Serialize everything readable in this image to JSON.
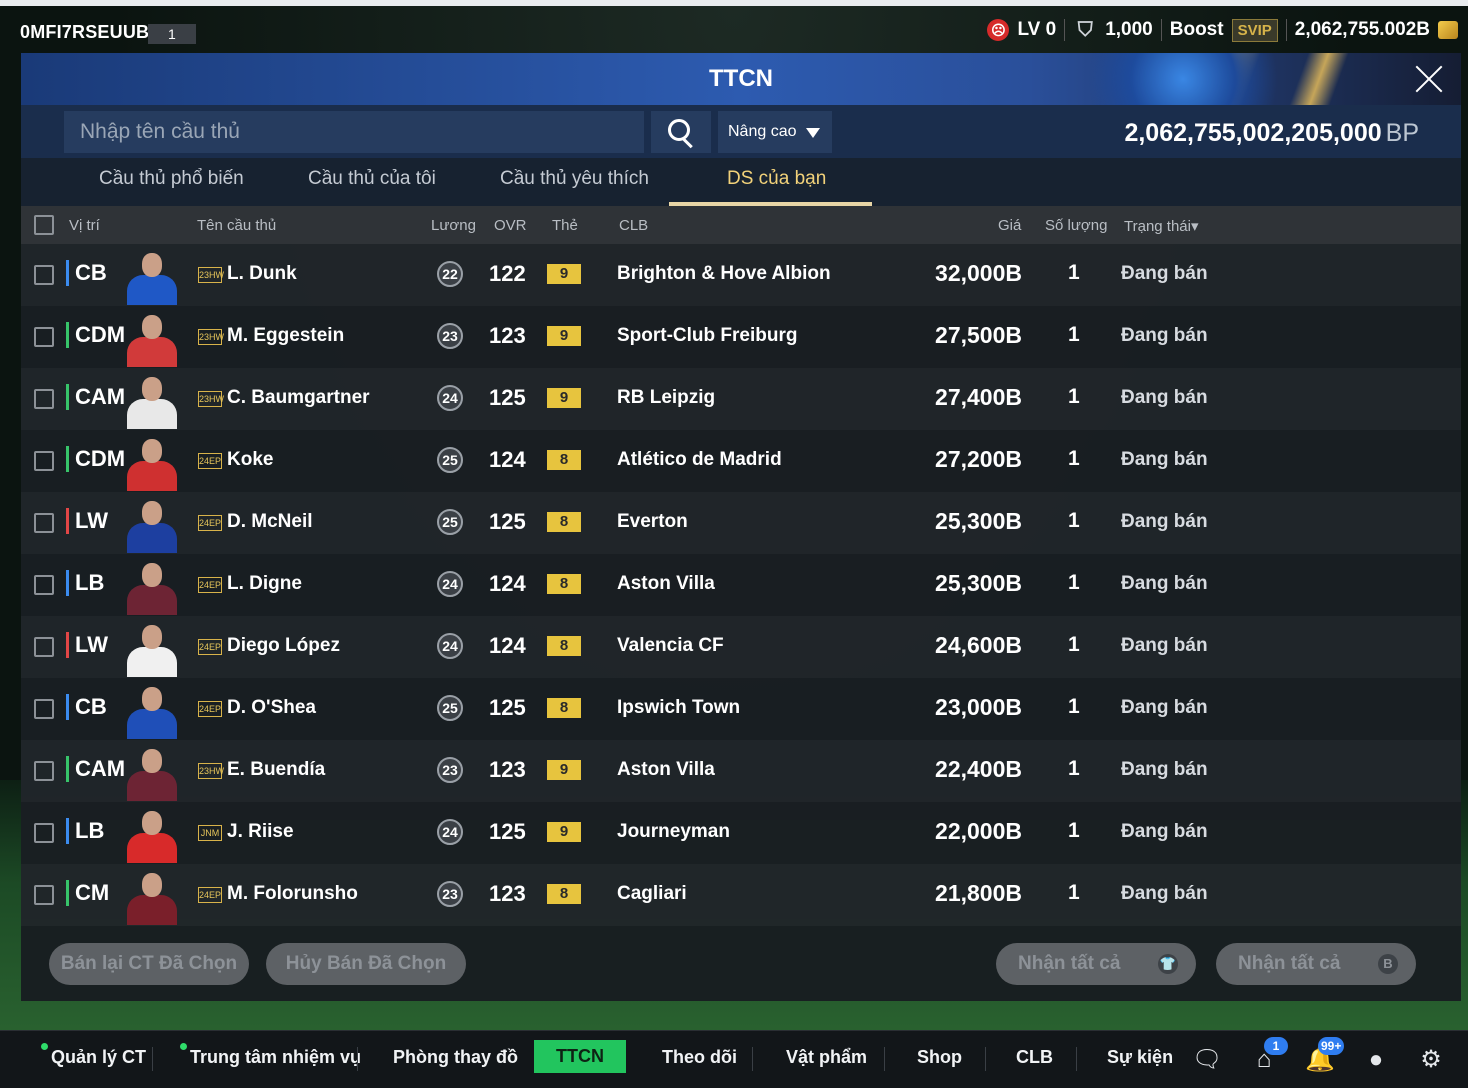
{
  "topbar": {
    "user_id": "0MFI7RSEUUB1",
    "user_level": "1",
    "lv_label": "LV 0",
    "shield_value": "1,000",
    "boost_label": "Boost",
    "svip_label": "SVIP",
    "currency_value": "2,062,755.002B"
  },
  "panel": {
    "title": "TTCN",
    "search_placeholder": "Nhập tên cầu thủ",
    "advanced_label": "Nâng cao",
    "bp_amount": "2,062,755,002,205,000",
    "bp_unit": "BP"
  },
  "tabs": [
    {
      "label": "Cầu thủ phổ biến"
    },
    {
      "label": "Cầu thủ của tôi"
    },
    {
      "label": "Cầu thủ yêu thích"
    },
    {
      "label": "DS của bạn"
    }
  ],
  "table": {
    "headers": {
      "position": "Vị trí",
      "name": "Tên cầu thủ",
      "salary": "Lương",
      "ovr": "OVR",
      "card": "Thẻ",
      "club": "CLB",
      "price": "Giá",
      "quantity": "Số lượng",
      "status": "Trạng thái▾"
    },
    "rows": [
      {
        "pos": "CB",
        "pos_color": "#3b8cf0",
        "season": "23HW",
        "name": "L. Dunk",
        "salary": "22",
        "ovr": "122",
        "card": "9",
        "club": "Brighton & Hove Albion",
        "price": "32,000B",
        "qty": "1",
        "status": "Đang bán",
        "shirt": "#1f58c6"
      },
      {
        "pos": "CDM",
        "pos_color": "#37c46a",
        "season": "23HW",
        "name": "M. Eggestein",
        "salary": "23",
        "ovr": "123",
        "card": "9",
        "club": "Sport-Club Freiburg",
        "price": "27,500B",
        "qty": "1",
        "status": "Đang bán",
        "shirt": "#d13a3a"
      },
      {
        "pos": "CAM",
        "pos_color": "#37c46a",
        "season": "23HW",
        "name": "C. Baumgartner",
        "salary": "24",
        "ovr": "125",
        "card": "9",
        "club": "RB Leipzig",
        "price": "27,400B",
        "qty": "1",
        "status": "Đang bán",
        "shirt": "#e8e8e8"
      },
      {
        "pos": "CDM",
        "pos_color": "#37c46a",
        "season": "24EP",
        "name": "Koke",
        "salary": "25",
        "ovr": "124",
        "card": "8",
        "club": "Atlético de Madrid",
        "price": "27,200B",
        "qty": "1",
        "status": "Đang bán",
        "shirt": "#cf3030"
      },
      {
        "pos": "LW",
        "pos_color": "#e24646",
        "season": "24EP",
        "name": "D. McNeil",
        "salary": "25",
        "ovr": "125",
        "card": "8",
        "club": "Everton",
        "price": "25,300B",
        "qty": "1",
        "status": "Đang bán",
        "shirt": "#1d3fa0"
      },
      {
        "pos": "LB",
        "pos_color": "#3b8cf0",
        "season": "24EP",
        "name": "L. Digne",
        "salary": "24",
        "ovr": "124",
        "card": "8",
        "club": "Aston Villa",
        "price": "25,300B",
        "qty": "1",
        "status": "Đang bán",
        "shirt": "#6d2434"
      },
      {
        "pos": "LW",
        "pos_color": "#e24646",
        "season": "24EP",
        "name": "Diego López",
        "salary": "24",
        "ovr": "124",
        "card": "8",
        "club": "Valencia CF",
        "price": "24,600B",
        "qty": "1",
        "status": "Đang bán",
        "shirt": "#f0f0f0"
      },
      {
        "pos": "CB",
        "pos_color": "#3b8cf0",
        "season": "24EP",
        "name": "D. O'Shea",
        "salary": "25",
        "ovr": "125",
        "card": "8",
        "club": "Ipswich Town",
        "price": "23,000B",
        "qty": "1",
        "status": "Đang bán",
        "shirt": "#1f4fb8"
      },
      {
        "pos": "CAM",
        "pos_color": "#37c46a",
        "season": "23HW",
        "name": "E. Buendía",
        "salary": "23",
        "ovr": "123",
        "card": "9",
        "club": "Aston Villa",
        "price": "22,400B",
        "qty": "1",
        "status": "Đang bán",
        "shirt": "#6d2434"
      },
      {
        "pos": "LB",
        "pos_color": "#3b8cf0",
        "season": "JNM",
        "name": "J. Riise",
        "salary": "24",
        "ovr": "125",
        "card": "9",
        "club": "Journeyman",
        "price": "22,000B",
        "qty": "1",
        "status": "Đang bán",
        "shirt": "#d82a2a"
      },
      {
        "pos": "CM",
        "pos_color": "#37c46a",
        "season": "24EP",
        "name": "M. Folorunsho",
        "salary": "23",
        "ovr": "123",
        "card": "8",
        "club": "Cagliari",
        "price": "21,800B",
        "qty": "1",
        "status": "Đang bán",
        "shirt": "#7a1f2a"
      }
    ]
  },
  "actions": {
    "resell_selected": "Bán lại CT Đã Chọn",
    "cancel_selected": "Hủy Bán Đã Chọn",
    "receive_all_players": "Nhận tất cả",
    "receive_all_bp": "Nhận tất cả"
  },
  "bottom_nav": {
    "items": [
      {
        "label": "Quản lý CT"
      },
      {
        "label": "Trung tâm nhiệm vụ"
      },
      {
        "label": "Phòng thay đồ"
      },
      {
        "label": "TTCN"
      },
      {
        "label": "Theo dõi"
      },
      {
        "label": "Vật phẩm"
      },
      {
        "label": "Shop"
      },
      {
        "label": "CLB"
      },
      {
        "label": "Sự kiện"
      }
    ],
    "home_badge": "1",
    "notif_badge": "99+"
  },
  "icons": {
    "lv": "sad-face-icon",
    "shield": "shield-icon",
    "coin": "coin-stack-icon",
    "close": "close-icon",
    "search": "search-icon",
    "chat": "chat-icon",
    "home": "home-icon",
    "bell": "bell-icon",
    "profile": "profile-icon",
    "settings": "gear-icon"
  }
}
